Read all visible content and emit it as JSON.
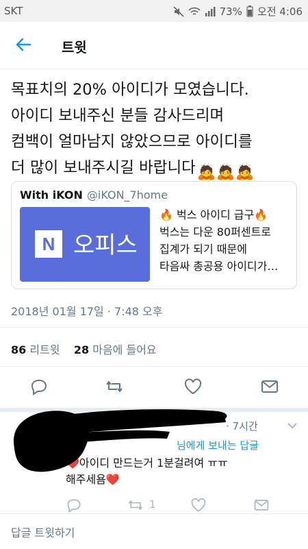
{
  "status_bar": {
    "carrier": "SKT",
    "battery": "73%",
    "time": "오전 4:06"
  },
  "header": {
    "title": "트윗"
  },
  "tweet": {
    "text": "목표치의 20% 아이디가 모였습니다.\n아이디 보내주신 분들 감사드리며\n컴백이 얼마남지 않았으므로 아이디를\n더 많이 보내주시길 바랍니다",
    "emoji": "🙇🙇🙇",
    "timestamp": "2018년 01월 17일 · 7:48 오후"
  },
  "quote": {
    "name": "With iKON",
    "handle": "@iKON_7home",
    "thumb_logo": "N",
    "thumb_label": "오피스",
    "lines": [
      "🔥 벅스 아이디 급구🔥",
      "벅스는 다운 80퍼센트로",
      "집계가 되기 때문에",
      "타음싸 총공용 아이디가…"
    ]
  },
  "stats": {
    "retweets_count": "86",
    "retweets_label": "리트윗",
    "likes_count": "28",
    "likes_label": "마음에 들어요"
  },
  "reply": {
    "time": "· 7시간",
    "context": "님에게 보내는 답글",
    "text_line1": "❤️아이디 만드는거 1분걸려여 ㅠㅠ",
    "text_line2": "해주세욤❤️",
    "retweet_count": "1"
  },
  "compose": {
    "label": "답글 트윗하기"
  },
  "colors": {
    "accent": "#1b95e0",
    "muted": "#657786",
    "thumb_bg": "#5a6edb"
  }
}
